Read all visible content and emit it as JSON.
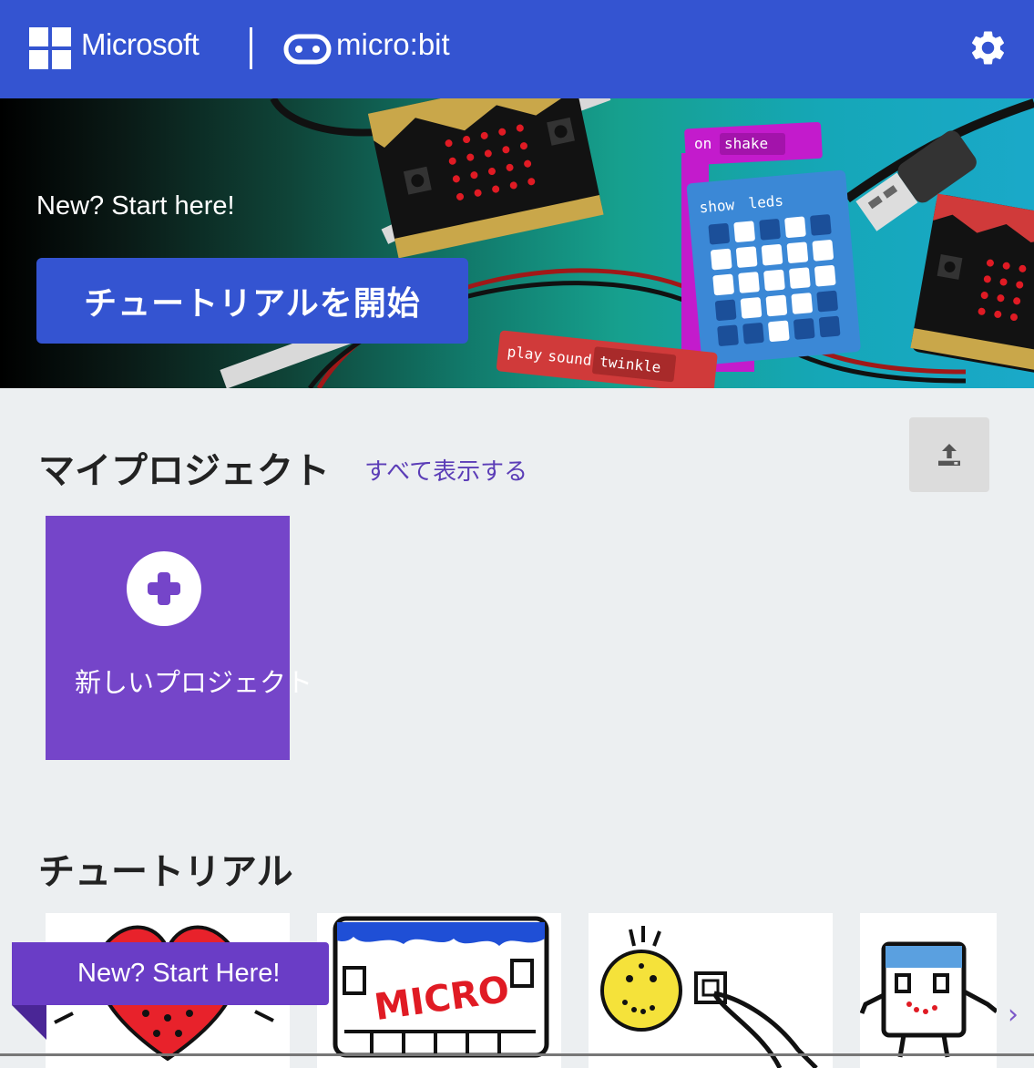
{
  "header": {
    "brand": "Microsoft",
    "product": "micro:bit",
    "settings_icon": "gear-icon"
  },
  "hero": {
    "tagline": "New? Start here!",
    "start_button": "チュートリアルを開始",
    "blocks": [
      "on",
      "shake",
      "show",
      "leds",
      "play",
      "sound",
      "twinkle"
    ]
  },
  "projects": {
    "title": "マイプロジェクト",
    "see_all": "すべて表示する",
    "import_icon": "upload-icon",
    "new_project_label": "新しいプロジェクト"
  },
  "tutorials": {
    "title": "チュートリアル",
    "ribbon": "New? Start Here!",
    "card_micro_text": "MICRO"
  },
  "colors": {
    "header": "#3454d1",
    "accent_purple": "#7545c9",
    "link_purple": "#5b3db7",
    "background": "#eceff1"
  }
}
